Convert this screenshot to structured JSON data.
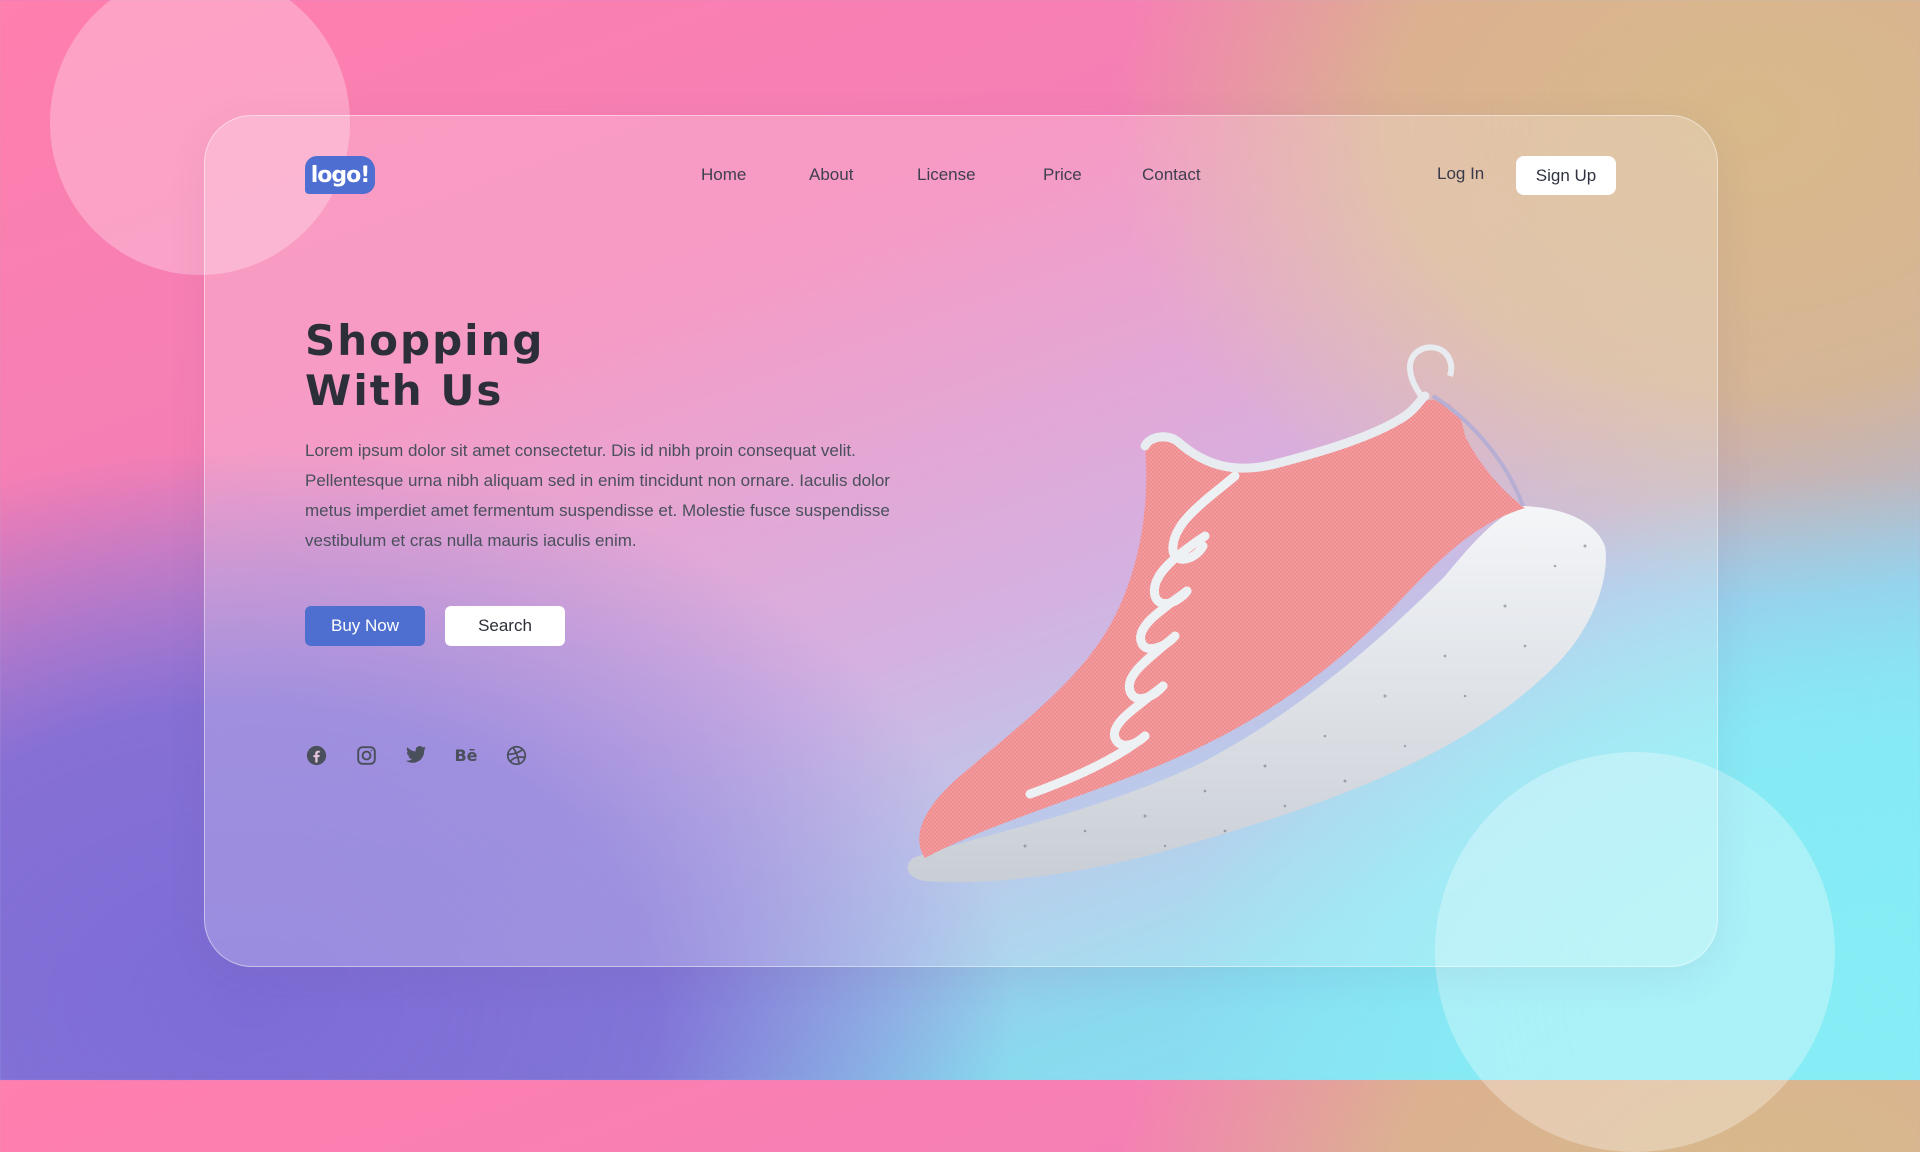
{
  "brand": {
    "logo_text": "logo!",
    "accent_color": "#4e6fd0"
  },
  "nav": {
    "items": [
      {
        "label": "Home"
      },
      {
        "label": "About"
      },
      {
        "label": "License"
      },
      {
        "label": "Price"
      },
      {
        "label": "Contact"
      }
    ],
    "login_label": "Log In",
    "signup_label": "Sign Up"
  },
  "hero": {
    "title_line1": "Shopping",
    "title_line2": "With Us",
    "description": "Lorem ipsum dolor sit amet consectetur. Dis id nibh proin consequat velit. Pellentesque urna nibh aliquam sed in enim tincidunt non ornare. Iaculis dolor metus imperdiet amet fermentum suspendisse et. Molestie fusce suspendisse vestibulum et cras nulla mauris iaculis enim.",
    "buy_label": "Buy Now",
    "search_label": "Search"
  },
  "social": {
    "icons": [
      "facebook-icon",
      "instagram-icon",
      "twitter-icon",
      "behance-icon",
      "dribbble-icon"
    ],
    "behance_text": "Bē"
  },
  "colors": {
    "bg_pink": "#ff7fae",
    "bg_gold": "#d8b98a",
    "bg_purple": "#7d6cd6",
    "bg_cyan": "#86ecf5",
    "text_dark": "#2c2f38"
  }
}
